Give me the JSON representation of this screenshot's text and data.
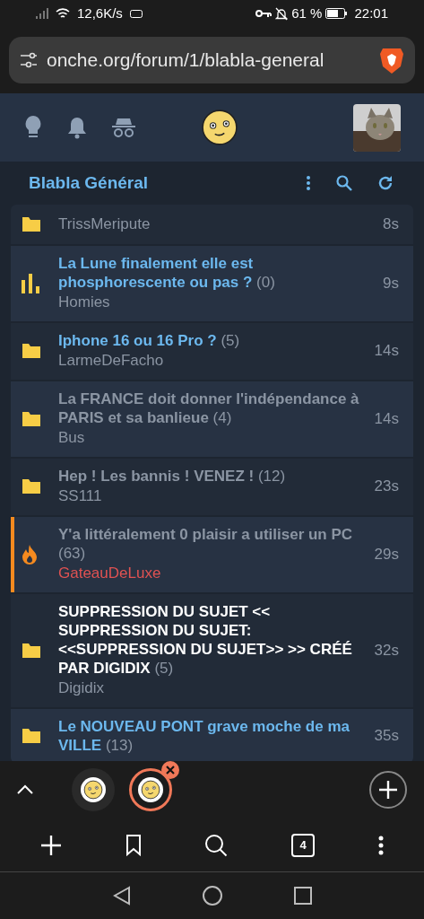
{
  "status_bar": {
    "speed": "12,6K/s",
    "battery": "61 %",
    "time": "22:01"
  },
  "address_bar": {
    "url": "onche.org/forum/1/blabla-general"
  },
  "forum": {
    "title": "Blabla Général"
  },
  "topics": [
    {
      "kind": "folder",
      "author": "TrissMeripute",
      "author_highlighted": false,
      "time": "8s"
    },
    {
      "kind": "poll",
      "unread": true,
      "pinned": false,
      "title": "La Lune finalement elle est phosphorescente ou pas ?",
      "count": "(0)",
      "author": "Homies",
      "author_highlighted": false,
      "time": "9s"
    },
    {
      "kind": "folder",
      "unread": true,
      "pinned": false,
      "title": "Iphone 16 ou 16 Pro ?",
      "count": "(5)",
      "author": "LarmeDeFacho",
      "author_highlighted": false,
      "time": "14s"
    },
    {
      "kind": "folder",
      "unread": false,
      "pinned": false,
      "title": "La FRANCE doit donner l'indépendance à PARIS et sa banlieue",
      "count": "(4)",
      "author": "Bus",
      "author_highlighted": false,
      "time": "14s"
    },
    {
      "kind": "folder",
      "unread": false,
      "pinned": false,
      "title": "Hep ! Les bannis ! VENEZ !",
      "count": "(12)",
      "author": "SS111",
      "author_highlighted": false,
      "time": "23s"
    },
    {
      "kind": "hot",
      "unread": false,
      "pinned": false,
      "title": "Y'a littéralement 0 plaisir a utiliser un PC",
      "count": "(63)",
      "author": "GateauDeLuxe",
      "author_highlighted": true,
      "time": "29s"
    },
    {
      "kind": "folder",
      "unread": false,
      "pinned": true,
      "title": "SUPPRESSION DU SUJET << SUPPRESSION DU SUJET: <<SUPPRESSION DU SUJET>> >> CRÉÉ PAR DIGIDIX",
      "count": "(5)",
      "author": "Digidix",
      "author_highlighted": false,
      "time": "32s"
    },
    {
      "kind": "folder",
      "unread": true,
      "pinned": false,
      "title": "Le NOUVEAU PONT grave moche de ma VILLE",
      "count": "(13)",
      "time": "35s"
    }
  ],
  "tab_strip": {
    "tabs": [
      {
        "selected": false
      },
      {
        "selected": true
      }
    ]
  },
  "toolbar": {
    "tab_count": "4"
  }
}
